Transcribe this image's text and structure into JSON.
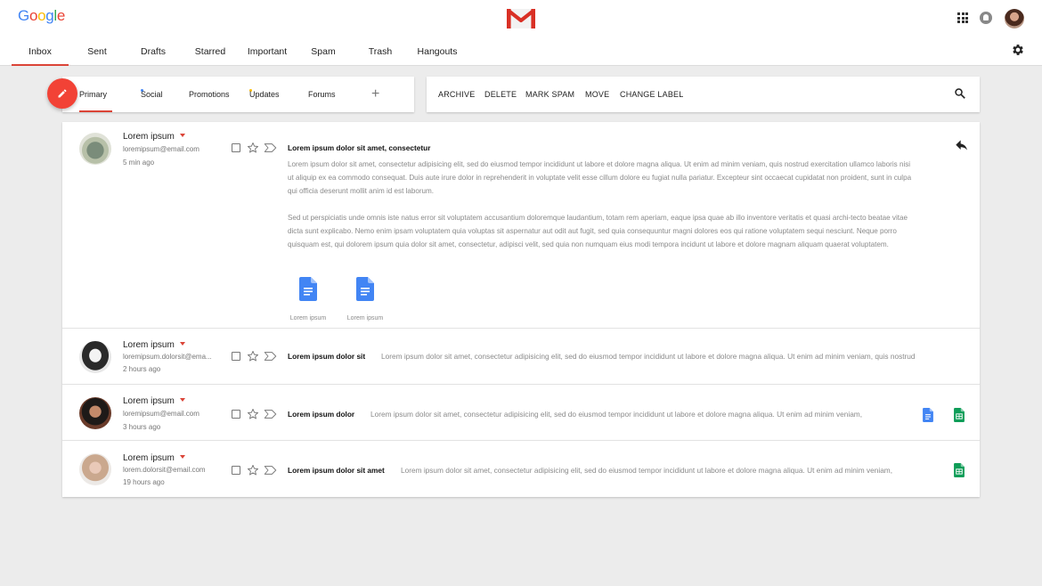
{
  "header": {
    "logo_letters": [
      "G",
      "o",
      "o",
      "g",
      "l",
      "e"
    ],
    "logo_colors": [
      "#4285f4",
      "#ea4335",
      "#fbbc05",
      "#4285f4",
      "#34a853",
      "#ea4335"
    ],
    "icons": [
      "gmail-icon",
      "apps-icon",
      "notifications-icon",
      "account-avatar",
      "settings-icon"
    ]
  },
  "tabs": [
    {
      "label": "Inbox",
      "active": true
    },
    {
      "label": "Sent"
    },
    {
      "label": "Drafts"
    },
    {
      "label": "Starred"
    },
    {
      "label": "Important"
    },
    {
      "label": "Spam"
    },
    {
      "label": "Trash"
    },
    {
      "label": "Hangouts"
    }
  ],
  "categories": [
    {
      "label": "Primary",
      "active": true
    },
    {
      "label": "Social",
      "dot": "#4285f4"
    },
    {
      "label": "Promotions"
    },
    {
      "label": "Updates",
      "dot": "#fbbc05"
    },
    {
      "label": "Forums"
    }
  ],
  "category_add": "+",
  "actions": [
    "ARCHIVE",
    "DELETE",
    "MARK SPAM",
    "MOVE",
    "CHANGE LABEL"
  ],
  "accent": "#db4437",
  "fab_color": "#f24236",
  "emails": [
    {
      "name": "Lorem ipsum",
      "email": "loremipsum@email.com",
      "time": "5 min ago",
      "subject": "Lorem ipsum dolor sit amet, consectetur",
      "expanded": true,
      "body": [
        "Lorem ipsum dolor sit amet, consectetur adipisicing elit, sed do eiusmod tempor incididunt ut labore et dolore magna aliqua. Ut enim ad minim veniam, quis nostrud exercitation ullamco laboris nisi ut aliquip ex ea commodo consequat. Duis aute irure dolor in reprehenderit in voluptate velit esse cillum dolore eu fugiat nulla pariatur. Excepteur sint occaecat cupidatat non proident, sunt in culpa qui officia deserunt mollit anim id est laborum.",
        "Sed ut perspiciatis unde omnis iste natus error sit voluptatem accusantium doloremque laudantium, totam rem aperiam, eaque ipsa quae ab illo inventore veritatis et quasi archi-tecto beatae vitae dicta sunt explicabo. Nemo enim ipsam voluptatem quia voluptas sit aspernatur aut odit aut fugit, sed quia consequuntur magni dolores eos qui ratione voluptatem sequi nesciunt. Neque porro quisquam est, qui dolorem ipsum quia dolor sit amet, consectetur, adipisci velit, sed quia non numquam eius modi tempora incidunt ut labore et dolore magnam aliquam quaerat voluptatem."
      ],
      "attachments": [
        {
          "label": "Lorem ipsum",
          "icon": "docs-icon"
        },
        {
          "label": "Lorem ipsum",
          "icon": "docs-icon"
        }
      ]
    },
    {
      "name": "Lorem ipsum",
      "email": "loremipsum.dolorsit@ema...",
      "time": "2 hours ago",
      "subject": "Lorem ipsum dolor sit",
      "snippet": "Lorem ipsum dolor sit amet, consectetur adipisicing elit, sed do eiusmod tempor incididunt ut labore et dolore magna aliqua. Ut enim ad minim veniam, quis nostrud"
    },
    {
      "name": "Lorem ipsum",
      "email": "loremipsum@email.com",
      "time": "3 hours ago",
      "subject": "Lorem ipsum dolor",
      "snippet": "Lorem ipsum dolor sit amet, consectetur adipisicing elit, sed do eiusmod tempor incididunt ut labore et dolore magna aliqua. Ut enim ad minim veniam,",
      "files": [
        "docs-icon",
        "sheets-icon"
      ]
    },
    {
      "name": "Lorem ipsum",
      "email": "lorem.dolorsit@email.com",
      "time": "19 hours ago",
      "subject": "Lorem ipsum dolor sit amet",
      "snippet": "Lorem ipsum dolor sit amet, consectetur adipisicing elit, sed do eiusmod tempor incididunt ut labore et dolore magna aliqua. Ut enim ad minim veniam,",
      "files": [
        "sheets-icon"
      ]
    }
  ]
}
